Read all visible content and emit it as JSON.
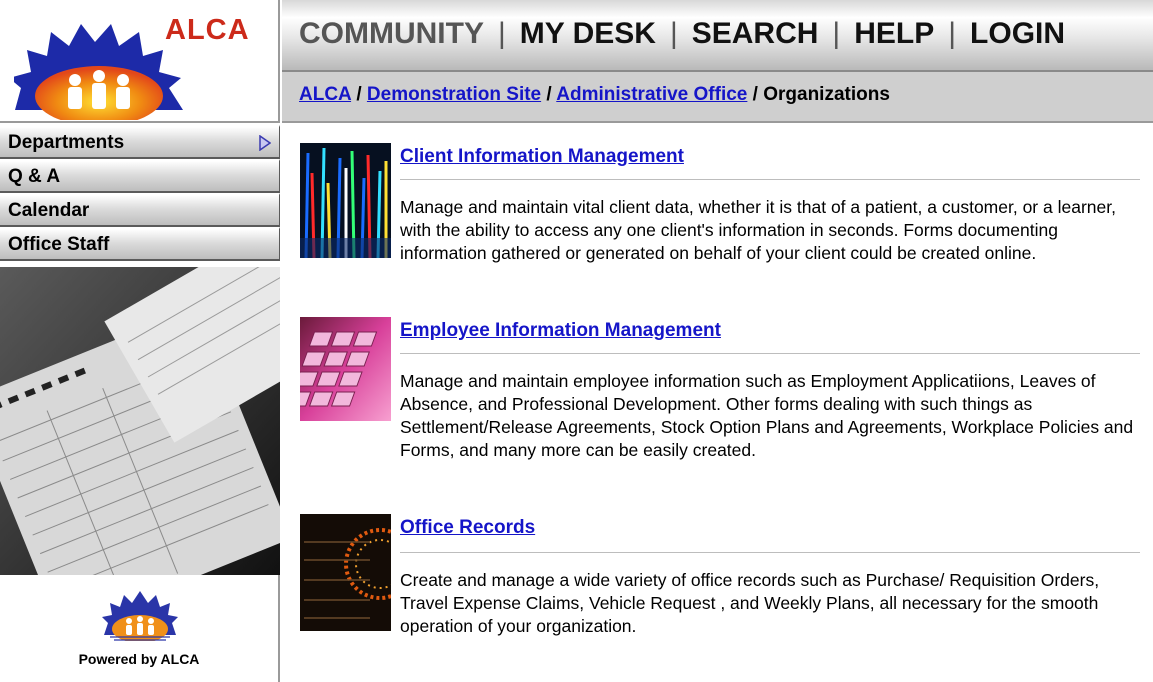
{
  "brand": {
    "logo_text": "ALCA",
    "accent": "#cc2a1a",
    "powered_by": "Powered by ALCA"
  },
  "topnav": {
    "items": [
      "COMMUNITY",
      "MY DESK",
      "SEARCH",
      "HELP",
      "LOGIN"
    ],
    "separator": "|"
  },
  "breadcrumb": {
    "links": [
      "ALCA",
      "Demonstration Site",
      "Administrative Office"
    ],
    "current": "Organizations",
    "separator": " / "
  },
  "sidebar": {
    "items": [
      {
        "label": "Departments",
        "icon": "triangle-right-icon"
      },
      {
        "label": "Q & A"
      },
      {
        "label": "Calendar"
      },
      {
        "label": "Office Staff"
      }
    ]
  },
  "main": {
    "items": [
      {
        "title": "Client Information Management",
        "description": "Manage and maintain vital client data, whether it is that of a patient, a customer, or a learner, with the ability to access any one client's information in seconds. Forms documenting information gathered or generated on behalf of your client could be created online."
      },
      {
        "title": "Employee Information Management",
        "description": "Manage and maintain employee information such as Employment Applicatiions, Leaves of Absence, and Professional Development. Other forms dealing with such things as Settlement/Release Agreements, Stock Option Plans and Agreements, Workplace Policies and Forms, and many more can be easily created."
      },
      {
        "title": "Office Records",
        "description": "Create and manage a wide variety of office records such as Purchase/ Requisition Orders, Travel Expense Claims, Vehicle Request , and Weekly Plans, all necessary for the smooth operation of your organization."
      }
    ]
  },
  "colors": {
    "link": "#1515c8",
    "nav_bg": "#e6e6e6",
    "crumb_bg": "#cfcfcf"
  }
}
